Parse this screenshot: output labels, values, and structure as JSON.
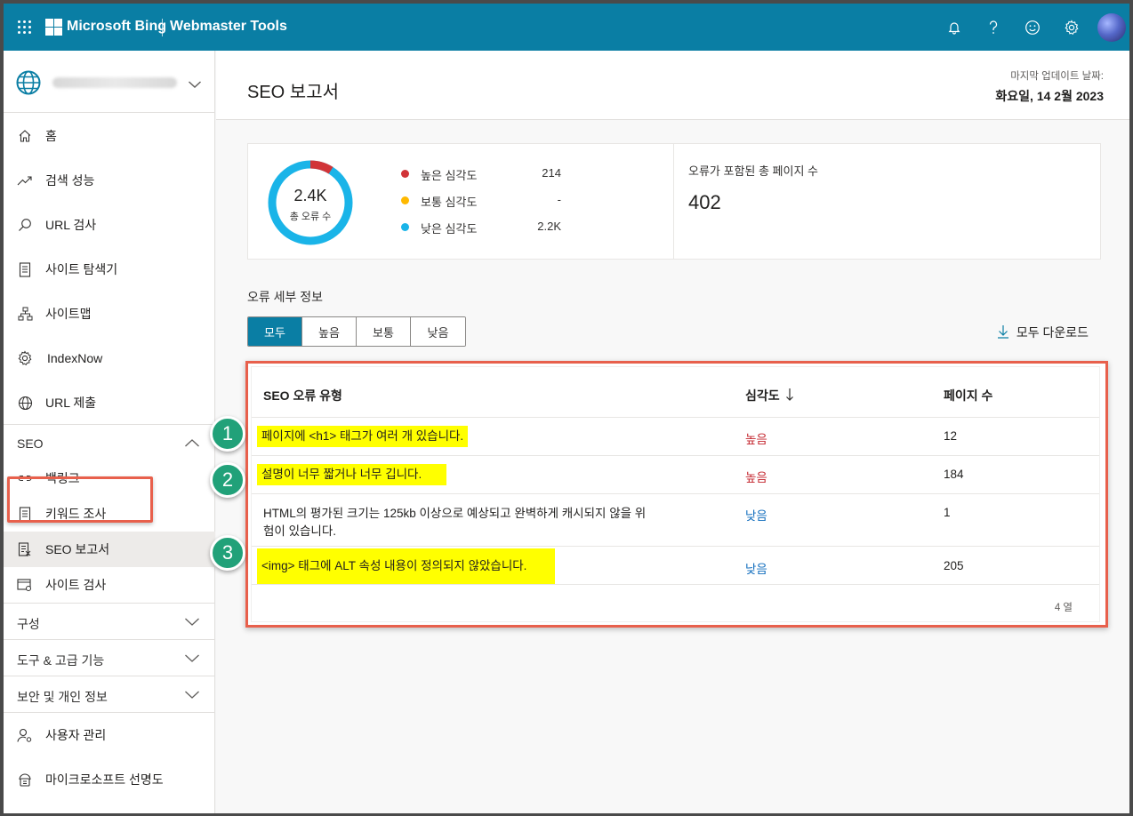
{
  "topbar": {
    "brand": "Microsoft Bing",
    "product": "Webmaster Tools",
    "icons": [
      "notification-bell-icon",
      "help-icon",
      "feedback-smiley-icon",
      "settings-gear-icon"
    ]
  },
  "sidebar": {
    "nav": [
      {
        "label": "홈",
        "icon": "home-icon"
      },
      {
        "label": "검색 성능",
        "icon": "trending-icon"
      },
      {
        "label": "URL 검사",
        "icon": "search-icon"
      },
      {
        "label": "사이트 탐색기",
        "icon": "document-icon"
      },
      {
        "label": "사이트맵",
        "icon": "sitemap-icon"
      },
      {
        "label": "IndexNow",
        "icon": "gear-icon"
      },
      {
        "label": "URL 제출",
        "icon": "globe-icon"
      }
    ],
    "seo_section": {
      "label": "SEO",
      "items": [
        {
          "label": "백링크",
          "icon": "link-icon"
        },
        {
          "label": "키워드 조사",
          "icon": "list-icon"
        },
        {
          "label": "SEO 보고서",
          "icon": "report-icon"
        },
        {
          "label": "사이트 검사",
          "icon": "scan-icon"
        }
      ]
    },
    "sections": [
      "구성",
      "도구 & 고급 기능",
      "보안 및 개인 정보"
    ],
    "bottom": [
      {
        "label": "사용자 관리",
        "icon": "user-settings-icon"
      },
      {
        "label": "마이크로소프트 선명도",
        "icon": "clarity-icon"
      }
    ]
  },
  "header": {
    "title": "SEO 보고서",
    "update_label": "마지막 업데이트 날짜:",
    "update_date": "화요일, 14 2월 2023"
  },
  "summary": {
    "total_value": "2.4K",
    "total_label": "총 오류 수",
    "legend": [
      {
        "label": "높은 심각도",
        "value": "214",
        "color": "#d13438"
      },
      {
        "label": "보통 심각도",
        "value": "-",
        "color": "#ffb900"
      },
      {
        "label": "낮은 심각도",
        "value": "2.2K",
        "color": "#1ab4e8"
      }
    ],
    "donut_fraction_high": 0.09,
    "pages_label": "오류가 포함된 총 페이지 수",
    "pages_value": "402"
  },
  "details": {
    "title": "오류 세부 정보",
    "filters": [
      "모두",
      "높음",
      "보통",
      "낮음"
    ],
    "active_filter": "모두",
    "download_label": "모두 다운로드",
    "columns": {
      "type": "SEO 오류 유형",
      "severity": "심각도",
      "pages": "페이지 수"
    },
    "rows": [
      {
        "type": "페이지에 <h1> 태그가 여러 개 있습니다.",
        "severity": "높음",
        "pages": "12"
      },
      {
        "type": "설명이 너무 짧거나 너무 깁니다.",
        "severity": "높음",
        "pages": "184"
      },
      {
        "type_line1": "HTML의 평가된 크기는 125kb 이상으로 예상되고 완벽하게 캐시되지 않을 위",
        "type_line2": "험이 있습니다.",
        "severity": "낮음",
        "pages": "1"
      },
      {
        "type": "<img> 태그에 ALT 속성 내용이 정의되지 않았습니다.",
        "severity": "낮음",
        "pages": "205"
      }
    ],
    "row_count": "4 열"
  },
  "badges": [
    "1",
    "2",
    "3"
  ]
}
